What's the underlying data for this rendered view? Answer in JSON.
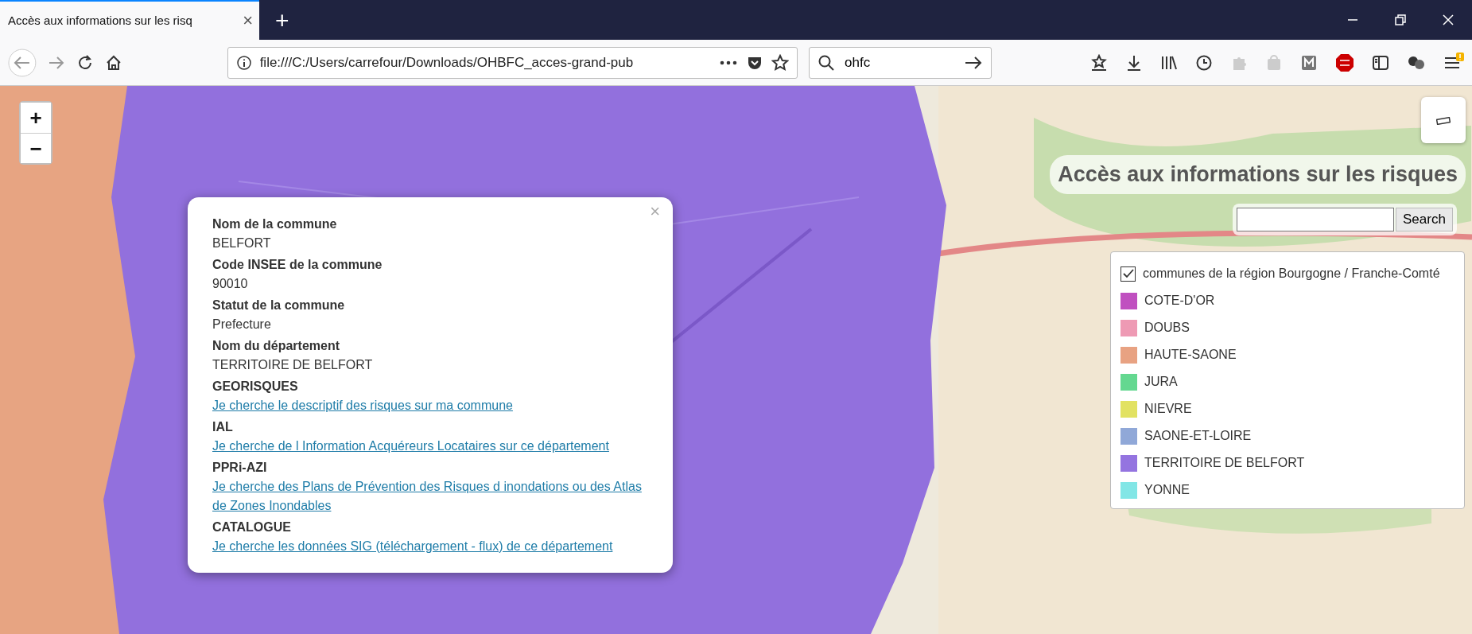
{
  "browser": {
    "tab": {
      "title": "Accès aux informations sur les risq",
      "close": "×",
      "selected": true
    },
    "new_tab": "+",
    "url": "file:///C:/Users/carrefour/Downloads/OHBFC_acces-grand-pub",
    "search": {
      "value": "ohfc"
    }
  },
  "map": {
    "zoom_in": "+",
    "zoom_out": "−",
    "title": "Accès aux informations sur les risques",
    "search": {
      "button": "Search"
    },
    "legend": {
      "layer": {
        "label": "communes de la région Bourgogne / Franche-Comté",
        "checked": true
      },
      "items": [
        {
          "label": "COTE-D'OR",
          "color": "#c050c0"
        },
        {
          "label": "DOUBS",
          "color": "#ee9ab4"
        },
        {
          "label": "HAUTE-SAONE",
          "color": "#e8a282"
        },
        {
          "label": "JURA",
          "color": "#64d890"
        },
        {
          "label": "NIEVRE",
          "color": "#e2e262"
        },
        {
          "label": "SAONE-ET-LOIRE",
          "color": "#90a8d8"
        },
        {
          "label": "TERRITOIRE DE BELFORT",
          "color": "#9474e0"
        },
        {
          "label": "YONNE",
          "color": "#82e6e6"
        }
      ]
    },
    "popup": {
      "close": "×",
      "fields": [
        {
          "label": "Nom de la commune",
          "value": "BELFORT",
          "kind": "text"
        },
        {
          "label": "Code INSEE de la commune",
          "value": "90010",
          "kind": "text"
        },
        {
          "label": "Statut de la commune",
          "value": "Prefecture",
          "kind": "text"
        },
        {
          "label": "Nom du département",
          "value": "TERRITOIRE DE BELFORT",
          "kind": "text"
        },
        {
          "label": "GEORISQUES",
          "value": "Je cherche le descriptif des risques sur ma commune",
          "kind": "link"
        },
        {
          "label": "IAL",
          "value": "Je cherche de l Information Acquéreurs Locataires sur ce département",
          "kind": "link"
        },
        {
          "label": "PPRi-AZI",
          "value": "Je cherche des Plans de Prévention des Risques d inondations ou des Atlas de Zones Inondables",
          "kind": "link"
        },
        {
          "label": "CATALOGUE",
          "value": "Je cherche les données SIG (téléchargement - flux) de ce département",
          "kind": "link"
        }
      ]
    }
  }
}
